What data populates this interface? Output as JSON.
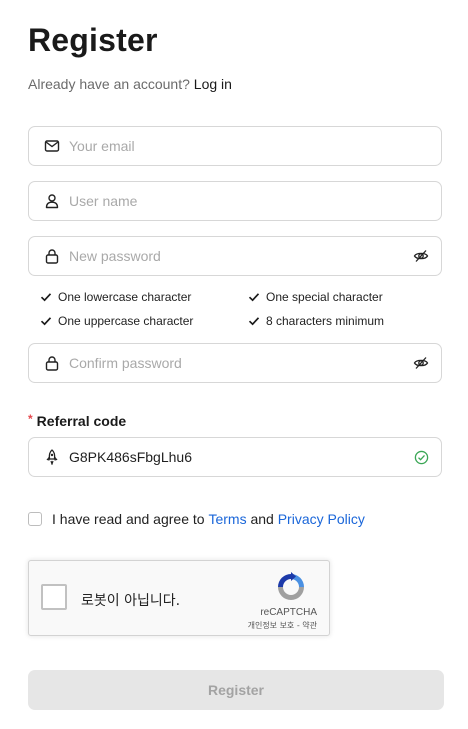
{
  "page": {
    "title": "Register"
  },
  "login_prompt": {
    "text": "Already have an account?",
    "link": "Log in"
  },
  "fields": {
    "email": {
      "placeholder": "Your email",
      "value": ""
    },
    "username": {
      "placeholder": "User name",
      "value": ""
    },
    "password": {
      "placeholder": "New password",
      "value": ""
    },
    "confirm_password": {
      "placeholder": "Confirm password",
      "value": ""
    },
    "referral": {
      "label": "Referral code",
      "required_mark": "*",
      "value": "G8PK486sFbgLhu6"
    }
  },
  "password_rules": [
    {
      "text": "One lowercase character",
      "met": true
    },
    {
      "text": "One special character",
      "met": true
    },
    {
      "text": "One uppercase character",
      "met": true
    },
    {
      "text": "8 characters minimum",
      "met": true
    }
  ],
  "agreement": {
    "text": "I have read and agree to",
    "terms": "Terms",
    "and": "and",
    "privacy": "Privacy Policy",
    "checked": false
  },
  "captcha": {
    "text": "로봇이 아닙니다.",
    "brand": "reCAPTCHA",
    "links": "개인정보 보호 - 약관"
  },
  "submit": {
    "label": "Register",
    "disabled": true
  },
  "icons": {
    "email": "envelope-icon",
    "user": "user-icon",
    "lock": "lock-icon",
    "eye_off": "eye-off-icon",
    "rocket": "rocket-icon",
    "check": "check-icon",
    "valid": "check-circle-icon"
  },
  "colors": {
    "link": "#1a66d9",
    "valid": "#3aa655",
    "required": "#e5484d",
    "button_disabled_bg": "#e6e6e6"
  }
}
